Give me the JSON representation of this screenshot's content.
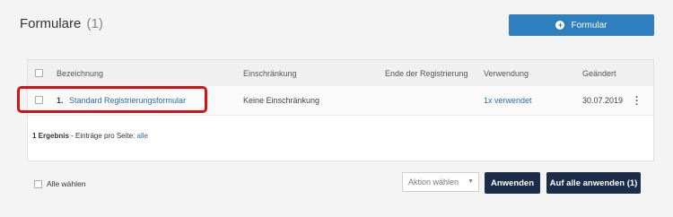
{
  "header": {
    "title": "Formulare",
    "count": "(1)",
    "add_button_label": "Formular"
  },
  "table": {
    "columns": [
      "Bezeichnung",
      "Einschränkung",
      "Ende der Registrierung",
      "Verwendung",
      "Geändert"
    ],
    "rows": [
      {
        "index": "1.",
        "name": "Standard Registrierungsformular",
        "restriction": "Keine Einschränkung",
        "end": "",
        "usage": "1x verwendet",
        "changed": "30.07.2019"
      }
    ]
  },
  "footer": {
    "result_count": "1 Ergebnis",
    "per_page_label": " - Einträge pro Seite: ",
    "per_page_value": "alle"
  },
  "bulk": {
    "select_all_label": "Alle wählen",
    "action_placeholder": "Aktion wählen",
    "apply_label": "Anwenden",
    "apply_all_label": "Auf alle anwenden (1)"
  },
  "colors": {
    "accent": "#2e7fbf",
    "dark_button": "#1c2d4a",
    "highlight": "#d80f15",
    "link": "#2a6fa8"
  }
}
